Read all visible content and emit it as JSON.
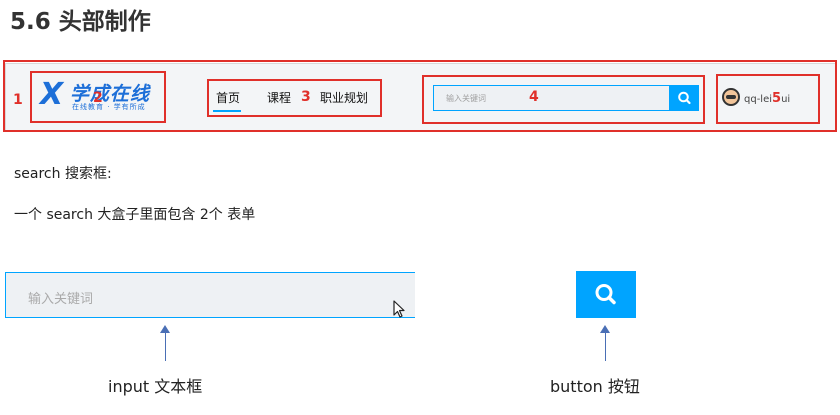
{
  "section_title": "5.6 头部制作",
  "header_mockup": {
    "logo": {
      "symbol": "X",
      "name": "学成在线",
      "tagline": "在线教育 · 学有所成"
    },
    "nav": [
      "首页",
      "课程",
      "职业规划"
    ],
    "search_placeholder": "输入关键词",
    "username": "qq-lei",
    "username_tail": "ui",
    "annotations": [
      "1",
      "2",
      "3",
      "4",
      "5"
    ]
  },
  "text_lines": {
    "line1": "search 搜索框:",
    "line2": "一个 search 大盒子里面包含 2个 表单"
  },
  "demo": {
    "input_placeholder": "输入关键词",
    "input_caption": "input 文本框",
    "button_caption": "button 按钮"
  },
  "colors": {
    "accent": "#00a4ff",
    "annotation_red": "#e0302a",
    "logo_blue": "#1d6fd8",
    "arrow_blue": "#4a6fb5"
  },
  "icons": [
    "search-icon",
    "avatar-icon",
    "cursor-icon",
    "arrow-up-icon"
  ]
}
